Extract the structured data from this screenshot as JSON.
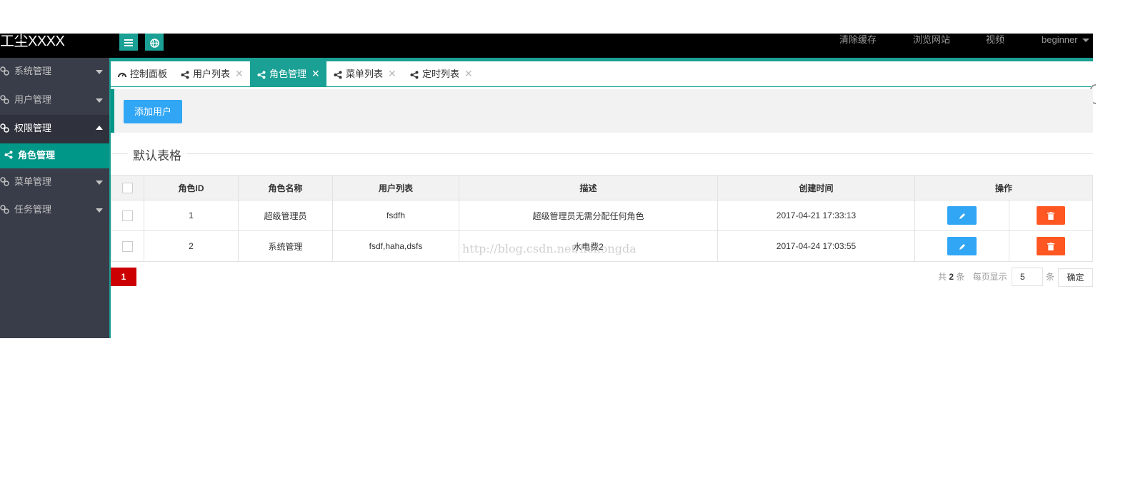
{
  "header": {
    "logo": "工尘XXXX",
    "menu_icon": "hamburger-icon",
    "globe_icon": "globe-icon",
    "nav": [
      "清除缓存",
      "浏览网站",
      "视频"
    ],
    "user": "beginner"
  },
  "sidebar": {
    "items": [
      {
        "label": "系统管理"
      },
      {
        "label": "用户管理"
      },
      {
        "label": "权限管理"
      },
      {
        "label": "菜单管理"
      },
      {
        "label": "任务管理"
      }
    ],
    "sub_item": "角色管理"
  },
  "tabs": [
    {
      "label": "控制面板",
      "icon": "dashboard-icon"
    },
    {
      "label": "用户列表",
      "icon": "share-icon"
    },
    {
      "label": "角色管理",
      "icon": "share-icon"
    },
    {
      "label": "菜单列表",
      "icon": "share-icon"
    },
    {
      "label": "定时列表",
      "icon": "share-icon"
    }
  ],
  "tab_close": "✕",
  "toolbar": {
    "add_label": "添加用户"
  },
  "fieldset": {
    "title": "默认表格"
  },
  "table": {
    "headers": [
      "角色ID",
      "角色名称",
      "用户列表",
      "描述",
      "创建时间",
      "操作"
    ],
    "rows": [
      {
        "id": "1",
        "name": "超级管理员",
        "users": "fsdfh",
        "desc": "超级管理员无需分配任何角色",
        "created": "2017-04-21 17:33:13"
      },
      {
        "id": "2",
        "name": "系统管理",
        "users": "fsdf,haha,dsfs",
        "desc": "水电费2",
        "created": "2017-04-24 17:03:55"
      }
    ]
  },
  "watermark": "http://blog.csdn.net/lichongda",
  "pager": {
    "current": "1",
    "total_prefix": "共",
    "total": "2",
    "total_suffix": "条",
    "per_page_label": "每页显示",
    "per_page": "5",
    "per_page_suffix": "条",
    "confirm": "确定"
  },
  "colors": {
    "accent": "#1aa094",
    "blue": "#31a6f5",
    "danger": "#ff5722",
    "sidebar": "#393d49"
  }
}
